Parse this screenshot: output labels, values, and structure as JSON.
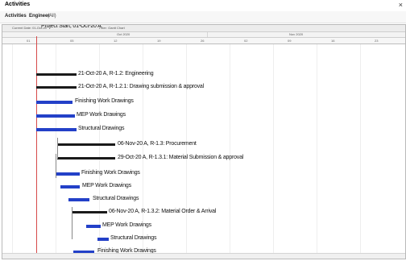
{
  "window": {
    "title": "Activities",
    "close_glyph": "×"
  },
  "filter": {
    "label": "Activities",
    "value": "Engineer",
    "extra": "(All)"
  },
  "header": {
    "left_label": "Current Date: 01-Oct-20",
    "mid_label": "Filter: Gantt Chart",
    "group_a": "Oct 2020",
    "group_b": "Nov 2020",
    "ticks": [
      "01",
      "05",
      "12",
      "19",
      "26",
      "02",
      "09",
      "16",
      "23"
    ]
  },
  "rows": [
    {
      "label": "Project Start, 01-Oct-20 A",
      "kind": "milestone"
    },
    {
      "label": "21-Oct-20 A, R-1.2: Engineering",
      "kind": "summary"
    },
    {
      "label": "21-Oct-20 A, R-1.2.1: Drawing submission & approval",
      "kind": "summary"
    },
    {
      "label": "Finishing Work Drawings",
      "kind": "task"
    },
    {
      "label": "MEP Work Drawings",
      "kind": "task"
    },
    {
      "label": "Structural Drawings",
      "kind": "task"
    },
    {
      "label": "06-Nov-20 A, R-1.3: Procurement",
      "kind": "summary"
    },
    {
      "label": "29-Oct-20 A, R-1.3.1: Material Submission & approval",
      "kind": "summary"
    },
    {
      "label": "Finishing Work Drawings",
      "kind": "task"
    },
    {
      "label": "MEP Work Drawings",
      "kind": "task"
    },
    {
      "label": "Structural Drawings",
      "kind": "task"
    },
    {
      "label": "06-Nov-20 A, R-1.3.2: Material Order & Arrival",
      "kind": "summary"
    },
    {
      "label": "MEP Work Drawings",
      "kind": "task"
    },
    {
      "label": "Structural Drawings",
      "kind": "task"
    },
    {
      "label": "Finishing Work Drawings",
      "kind": "task"
    }
  ],
  "colors": {
    "summary_bar": "#1a1a1a",
    "task_bar": "#2340c8",
    "today_line": "#d64a4a"
  }
}
